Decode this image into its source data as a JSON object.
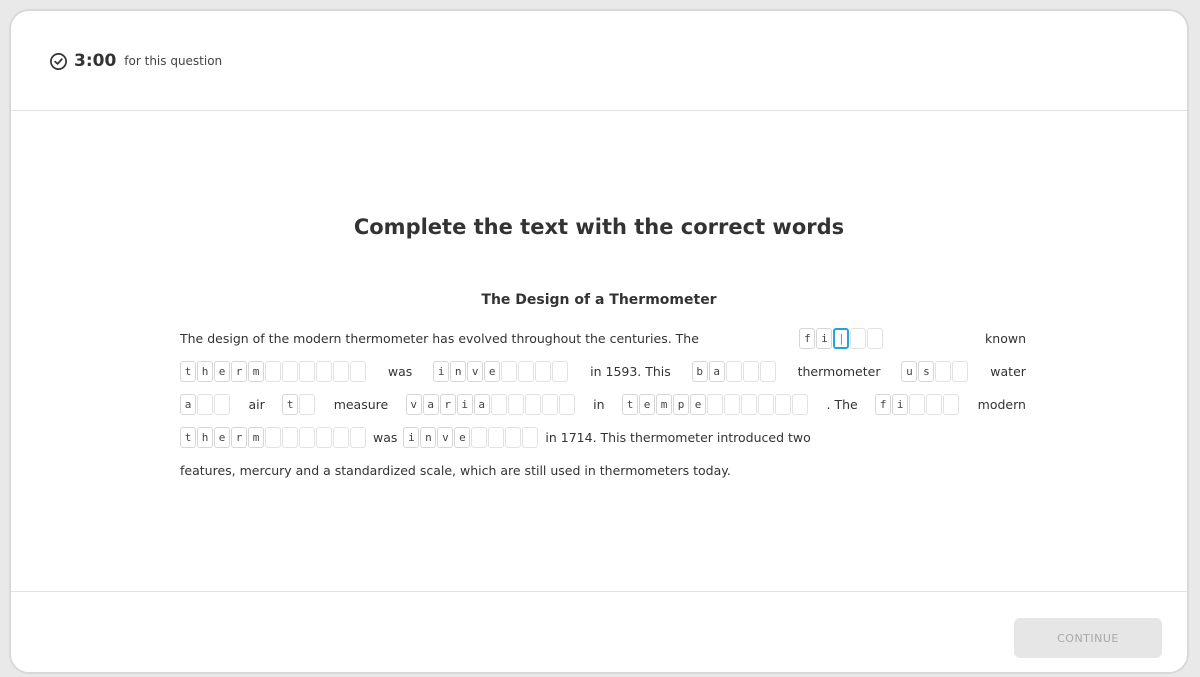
{
  "header": {
    "timer_value": "3:00",
    "timer_label": "for this question",
    "timer_icon": "clock-icon"
  },
  "question_title": "Complete the text with the correct words",
  "passage": {
    "title": "The Design of a Thermometer",
    "lines": [
      [
        {
          "t": "text",
          "v": "The design of the modern thermometer has evolved throughout the centuries. The"
        },
        {
          "t": "blank",
          "given": [
            "f",
            "i"
          ],
          "empty": 3,
          "active": 0
        },
        {
          "t": "text",
          "v": "known"
        }
      ],
      [
        {
          "t": "blank",
          "given": [
            "t",
            "h",
            "e",
            "r",
            "m"
          ],
          "empty": 6
        },
        {
          "t": "text",
          "v": "was"
        },
        {
          "t": "blank",
          "given": [
            "i",
            "n",
            "v",
            "e"
          ],
          "empty": 4
        },
        {
          "t": "text",
          "v": "in 1593. This"
        },
        {
          "t": "blank",
          "given": [
            "b",
            "a"
          ],
          "empty": 3
        },
        {
          "t": "text",
          "v": "thermometer"
        },
        {
          "t": "blank",
          "given": [
            "u",
            "s"
          ],
          "empty": 2
        },
        {
          "t": "text",
          "v": "water"
        }
      ],
      [
        {
          "t": "blank",
          "given": [
            "a"
          ],
          "empty": 2
        },
        {
          "t": "text",
          "v": "air"
        },
        {
          "t": "blank",
          "given": [
            "t"
          ],
          "empty": 1
        },
        {
          "t": "text",
          "v": "measure"
        },
        {
          "t": "blank",
          "given": [
            "v",
            "a",
            "r",
            "i",
            "a"
          ],
          "empty": 5
        },
        {
          "t": "text",
          "v": "in"
        },
        {
          "t": "blank",
          "given": [
            "t",
            "e",
            "m",
            "p",
            "e"
          ],
          "empty": 6
        },
        {
          "t": "text",
          "v": ". The"
        },
        {
          "t": "blank",
          "given": [
            "f",
            "i"
          ],
          "empty": 3
        },
        {
          "t": "text",
          "v": "modern"
        }
      ],
      [
        {
          "t": "blank",
          "given": [
            "t",
            "h",
            "e",
            "r",
            "m"
          ],
          "empty": 6
        },
        {
          "t": "text",
          "v": "was"
        },
        {
          "t": "blank",
          "given": [
            "i",
            "n",
            "v",
            "e"
          ],
          "empty": 4
        },
        {
          "t": "text",
          "v": "in 1714. This thermometer introduced two"
        }
      ],
      [
        {
          "t": "text",
          "v": "features, mercury and a standardized scale, which are still used in thermometers today."
        }
      ]
    ]
  },
  "footer": {
    "continue_label": "CONTINUE"
  },
  "colors": {
    "active_border": "#27a3d8",
    "button_disabled_bg": "#e6e6e6",
    "button_disabled_text": "#a8a8a8"
  }
}
